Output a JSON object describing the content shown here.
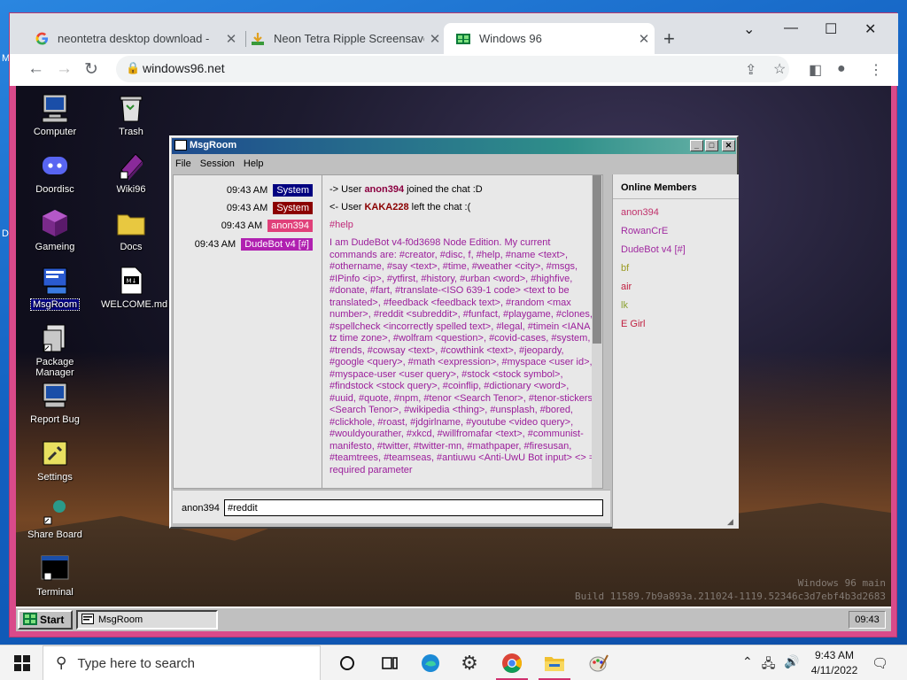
{
  "host": {
    "edge_letters": [
      "M",
      "D"
    ]
  },
  "browser": {
    "tabs": [
      {
        "title": "neontetra desktop download - ",
        "favicon": "google-icon"
      },
      {
        "title": "Neon Tetra Ripple Screensaver (",
        "favicon": "download-favicon-icon"
      },
      {
        "title": "Windows 96",
        "favicon": "windows96-favicon-icon",
        "active": true
      }
    ],
    "url": "windows96.net"
  },
  "desktop": {
    "icons_left": [
      "Computer",
      "Doordisc",
      "Gameing",
      "MsgRoom",
      "Package Manager",
      "Report Bug",
      "Settings",
      "Share Board",
      "Terminal"
    ],
    "icons_right": [
      "Trash",
      "Wiki96",
      "Docs",
      "WELCOME.md"
    ],
    "build_info": {
      "line1": "Windows 96 main",
      "line2": "Build 11589.7b9a893a.211024-1119.52346c3d7ebf4b3d2683"
    }
  },
  "msgroom": {
    "title": "MsgRoom",
    "menu": [
      "File",
      "Session",
      "Help"
    ],
    "messages": [
      {
        "time": "09:43 AM",
        "author": "System",
        "color": "#000080",
        "text_pre": "-> User ",
        "user": "anon394",
        "user_color": "#8b0040",
        "text_post": " joined the chat :D"
      },
      {
        "time": "09:43 AM",
        "author": "System",
        "color": "#8b0000",
        "text_pre": "<- User ",
        "user": "KAKA228",
        "user_color": "#8b0000",
        "text_post": " left the chat :("
      },
      {
        "time": "09:43 AM",
        "author": "anon394",
        "color": "#e0407a",
        "text": "#help"
      },
      {
        "time": "09:43 AM",
        "author": "DudeBot v4 [#]",
        "color": "#b020b0"
      }
    ],
    "help_text": "I am DudeBot v4-f0d3698 Node Edition. My current commands are: #creator, #disc, f, #help, #name <text>, #othername, #say <text>, #time, #weather <city>, #msgs, #IPinfo <ip>, #ytfirst, #history, #urban <word>, #highfive, #donate, #fart, #translate-<ISO 639-1 code> <text to be translated>, #feedback <feedback text>, #random <max number>, #reddit <subreddit>, #funfact, #playgame, #clones, #spellcheck <incorrectly spelled text>, #legal, #timein <IANA tz time zone>, #wolfram <question>, #covid-cases, #system, #trends, #cowsay <text>, #cowthink <text>, #jeopardy, #google <query>, #math <expression>, #myspace <user id>, #myspace-user <user query>, #stock <stock symbol>, #findstock <stock query>, #coinflip, #dictionary <word>, #uuid, #quote, #npm, #tenor <Search Tenor>, #tenor-stickers <Search Tenor>, #wikipedia <thing>, #unsplash, #bored, #clickhole, #roast, #jdgirlname, #youtube <video query>, #wouldyourather, #xkcd, #willfromafar <text>, #communist-manifesto, #twitter, #twitter-mn, #mathpaper, #firesusan, #teamtrees, #teamseas, #antiuwu <Anti-UwU Bot input> <> = required parameter",
    "members_header": "Online Members",
    "members": [
      {
        "name": "anon394",
        "color": "#c0306a"
      },
      {
        "name": "RowanCrE",
        "color": "#a02aa0"
      },
      {
        "name": "DudeBot v4 [#]",
        "color": "#a02aa0"
      },
      {
        "name": "bf",
        "color": "#9a9a20"
      },
      {
        "name": "air",
        "color": "#c02040"
      },
      {
        "name": "lk",
        "color": "#8aa030"
      },
      {
        "name": "E Girl",
        "color": "#c02040"
      }
    ],
    "input_user": "anon394",
    "input_value": "#reddit "
  },
  "w96_taskbar": {
    "start": "Start",
    "task": "MsgRoom",
    "clock": "09:43"
  },
  "win_taskbar": {
    "search_placeholder": "Type here to search",
    "time": "9:43 AM",
    "date": "4/11/2022"
  }
}
